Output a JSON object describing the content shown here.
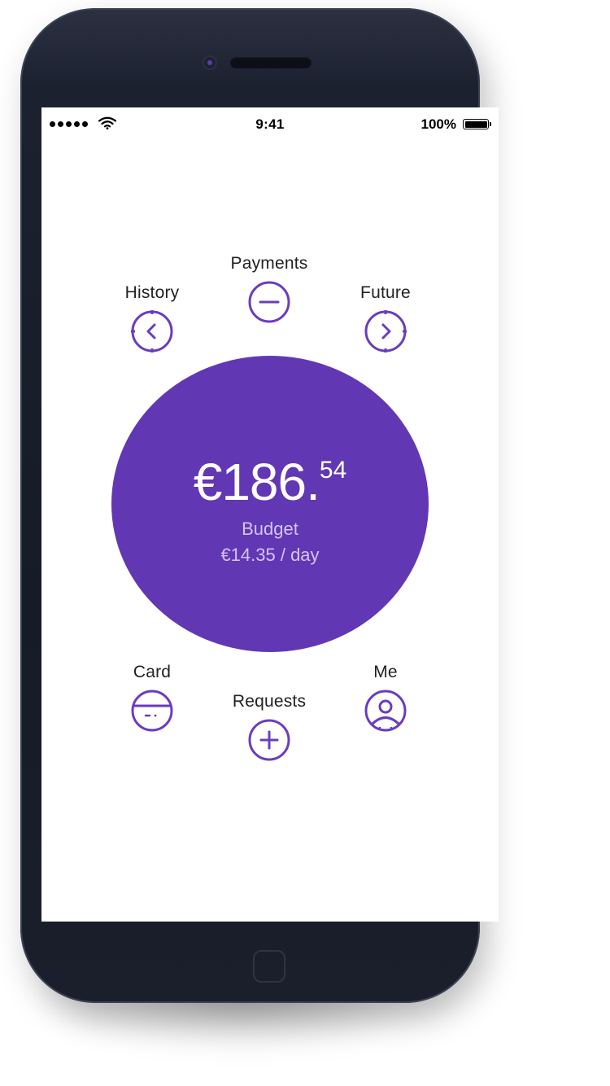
{
  "status_bar": {
    "time": "9:41",
    "battery_percent": "100%",
    "signal_bars": 5,
    "battery_level": 1.0
  },
  "nav": {
    "payments": {
      "label": "Payments",
      "icon": "minus-circle-icon"
    },
    "history": {
      "label": "History",
      "icon": "chevron-left-circle-icon"
    },
    "future": {
      "label": "Future",
      "icon": "chevron-right-circle-icon"
    },
    "card": {
      "label": "Card",
      "icon": "card-icon"
    },
    "requests": {
      "label": "Requests",
      "icon": "plus-circle-icon"
    },
    "me": {
      "label": "Me",
      "icon": "user-icon"
    }
  },
  "balance": {
    "main": "€186.",
    "cents": "54",
    "label": "Budget",
    "per_day": "€14.35 / day"
  },
  "colors": {
    "accent": "#6237b4",
    "icon_stroke": "#6a3cc0",
    "phone_body": "#1c2130"
  }
}
